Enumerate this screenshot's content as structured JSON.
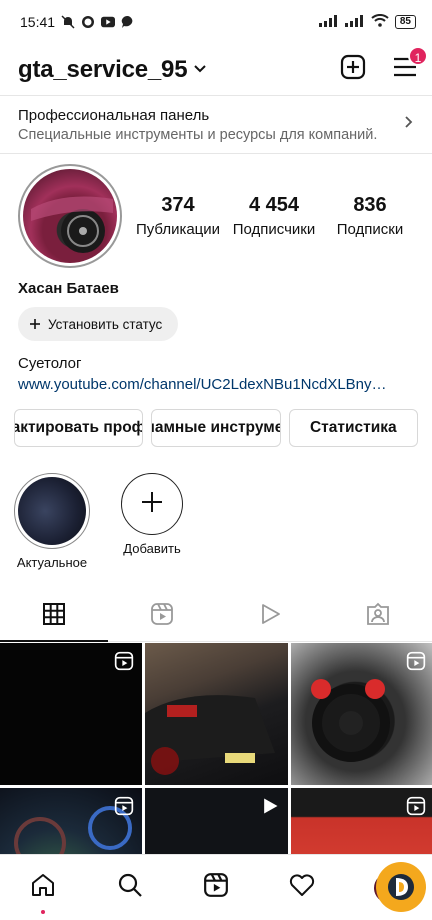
{
  "status_bar": {
    "time": "15:41",
    "battery": "85"
  },
  "header": {
    "username": "gta_service_95",
    "notification_count": "1"
  },
  "pro_panel": {
    "title": "Профессиональная панель",
    "subtitle": "Специальные инструменты и ресурсы для компаний."
  },
  "profile": {
    "stats": [
      {
        "value": "374",
        "label": "Публикации"
      },
      {
        "value": "4 454",
        "label": "Подписчики"
      },
      {
        "value": "836",
        "label": "Подписки"
      }
    ],
    "name": "Хасан Батаев",
    "status_button": "Установить статус",
    "bio": "Суетолог",
    "link": "www.youtube.com/channel/UC2LdexNBu1NcdXLBnyp..."
  },
  "action_buttons": {
    "edit": "Редактировать профиль",
    "ads": "Рекламные инструменты",
    "stats": "Статистика"
  },
  "highlights": [
    {
      "label": "Актуальное"
    },
    {
      "label": "Добавить"
    }
  ],
  "colors": {
    "accent_badge": "#e0245e",
    "link": "#00376b"
  },
  "icons": [
    "muted-bell-icon",
    "whatsapp-icon",
    "youtube-icon",
    "chat-icon",
    "signal-icon",
    "wifi-icon",
    "add-post-icon",
    "menu-icon",
    "chevron-right-icon",
    "grid-icon",
    "reels-icon",
    "video-play-icon",
    "tagged-icon",
    "home-icon",
    "search-icon",
    "heart-icon"
  ]
}
